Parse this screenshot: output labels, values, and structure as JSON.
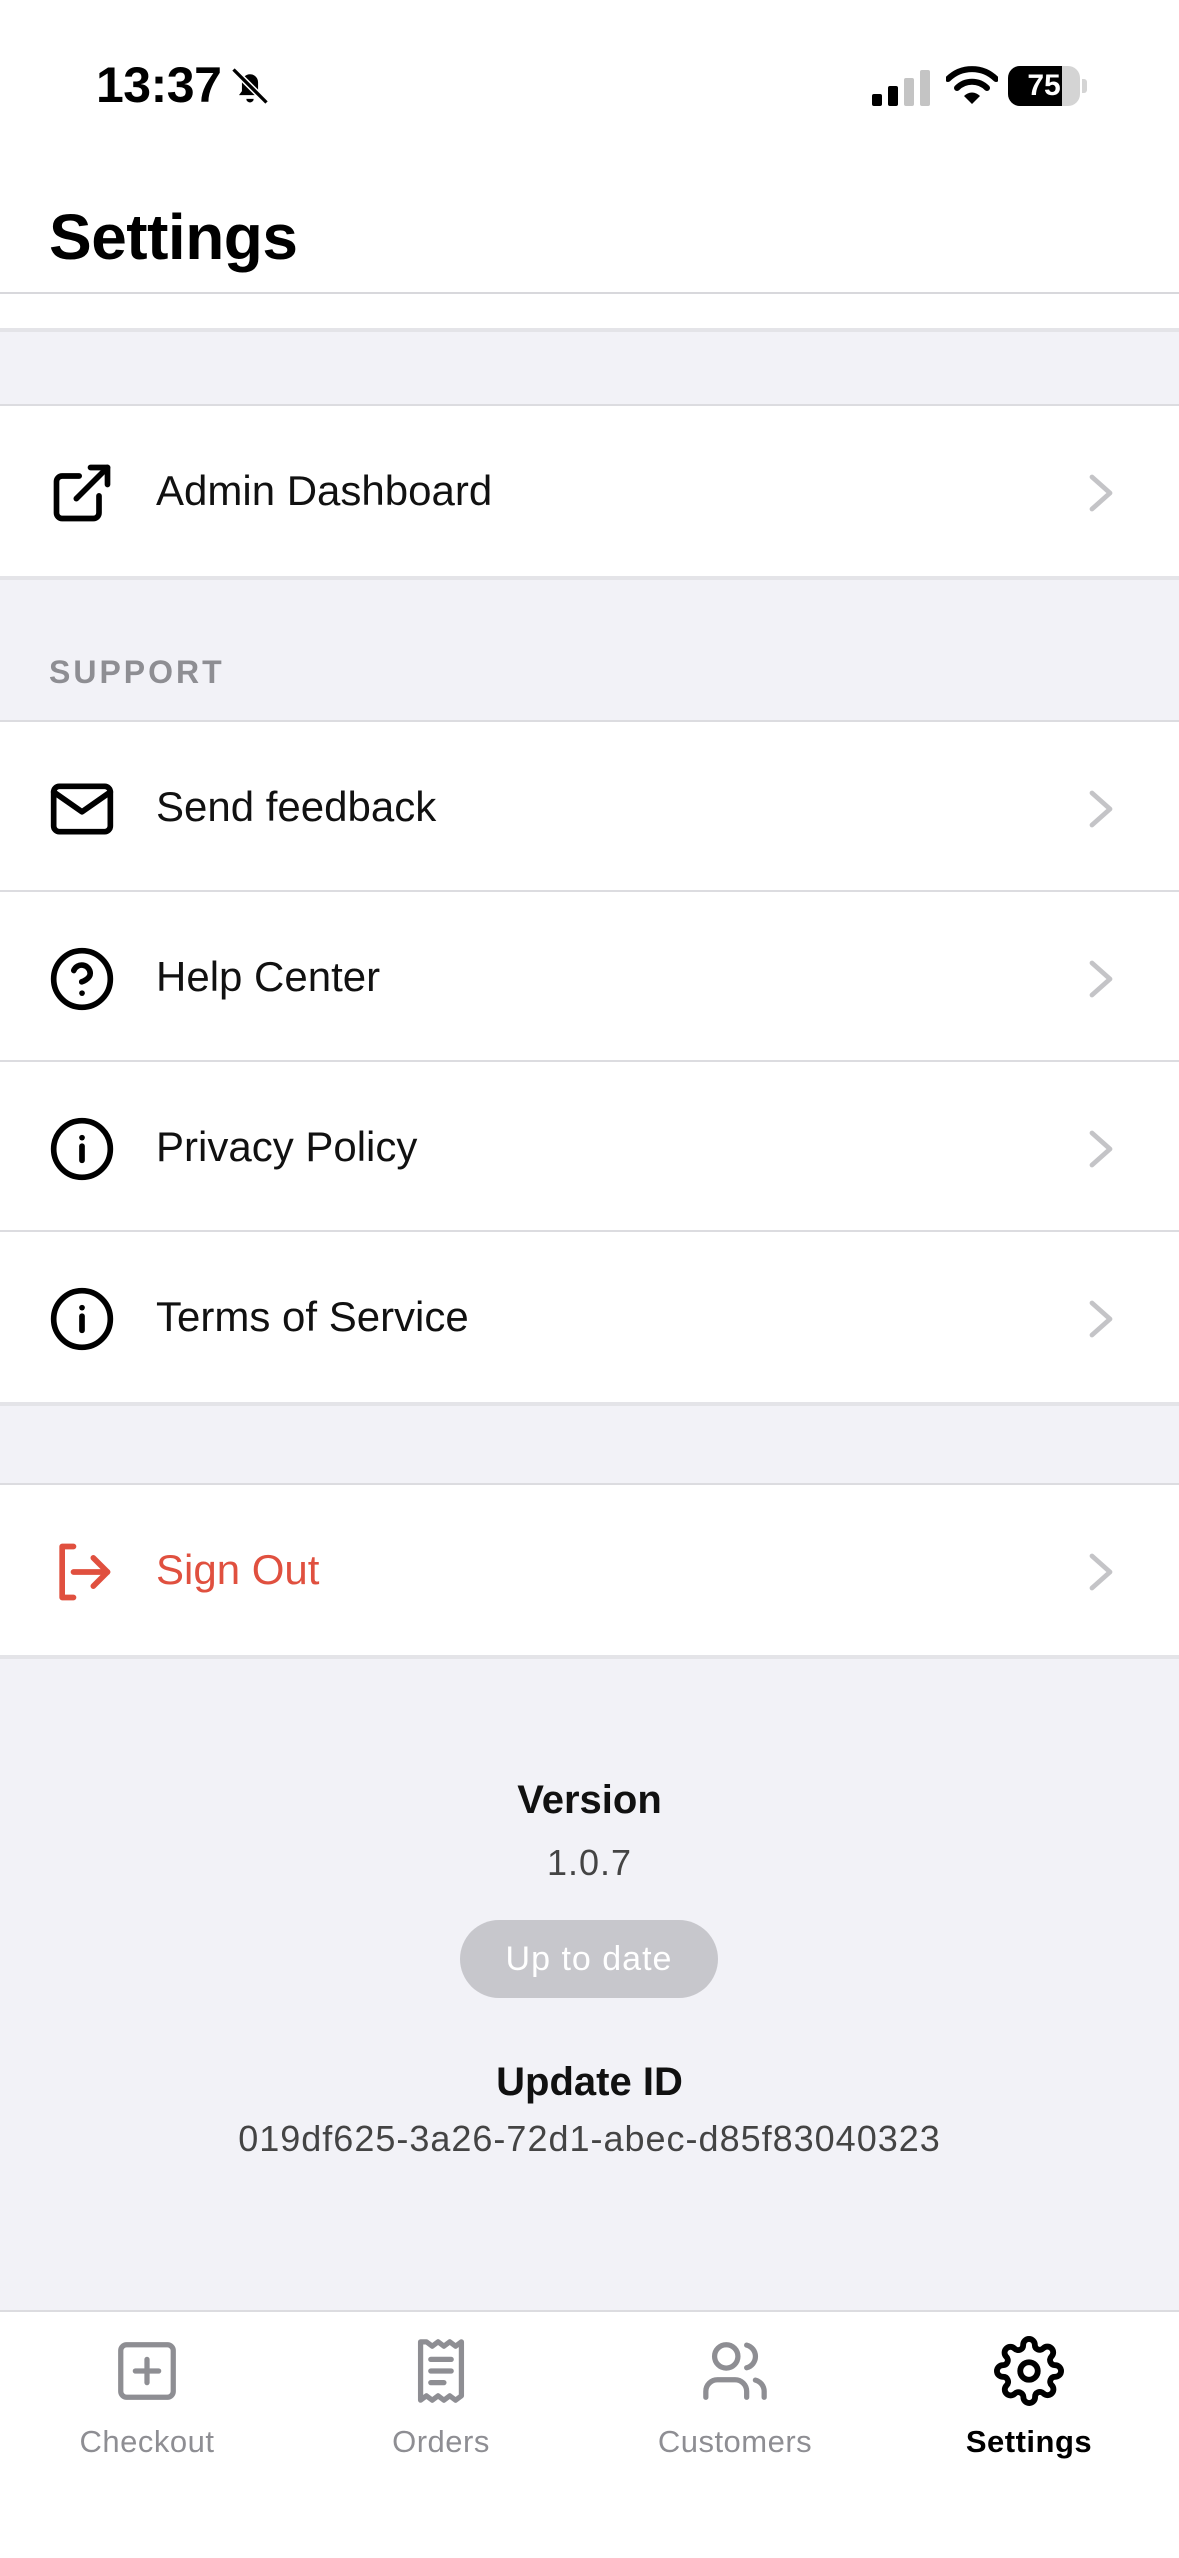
{
  "status_bar": {
    "time": "13:37",
    "battery_percent": "75",
    "battery_level": 0.75
  },
  "header": {
    "title": "Settings"
  },
  "groups": {
    "admin": {
      "items": [
        {
          "label": "Admin Dashboard",
          "icon": "external-link-icon"
        }
      ]
    },
    "support": {
      "header": "SUPPORT",
      "items": [
        {
          "label": "Send feedback",
          "icon": "mail-icon"
        },
        {
          "label": "Help Center",
          "icon": "help-circle-icon"
        },
        {
          "label": "Privacy Policy",
          "icon": "info-icon"
        },
        {
          "label": "Terms of Service",
          "icon": "info-icon"
        }
      ]
    },
    "account": {
      "items": [
        {
          "label": "Sign Out",
          "icon": "log-out-icon",
          "color": "#e0503f"
        }
      ]
    }
  },
  "version_info": {
    "version_label": "Version",
    "version_value": "1.0.7",
    "status_label": "Up to date",
    "update_id_label": "Update ID",
    "update_id_value": "019df625-3a26-72d1-abec-d85f83040323"
  },
  "tabbar": {
    "tabs": [
      {
        "label": "Checkout",
        "icon": "plus-square-icon",
        "active": false
      },
      {
        "label": "Orders",
        "icon": "receipt-icon",
        "active": false
      },
      {
        "label": "Customers",
        "icon": "users-icon",
        "active": false
      },
      {
        "label": "Settings",
        "icon": "gear-icon",
        "active": true
      }
    ]
  },
  "colors": {
    "background": "#f2f2f7",
    "danger": "#e0503f",
    "secondary_text": "#8e8e93",
    "pill_background": "#c7c7cc"
  }
}
